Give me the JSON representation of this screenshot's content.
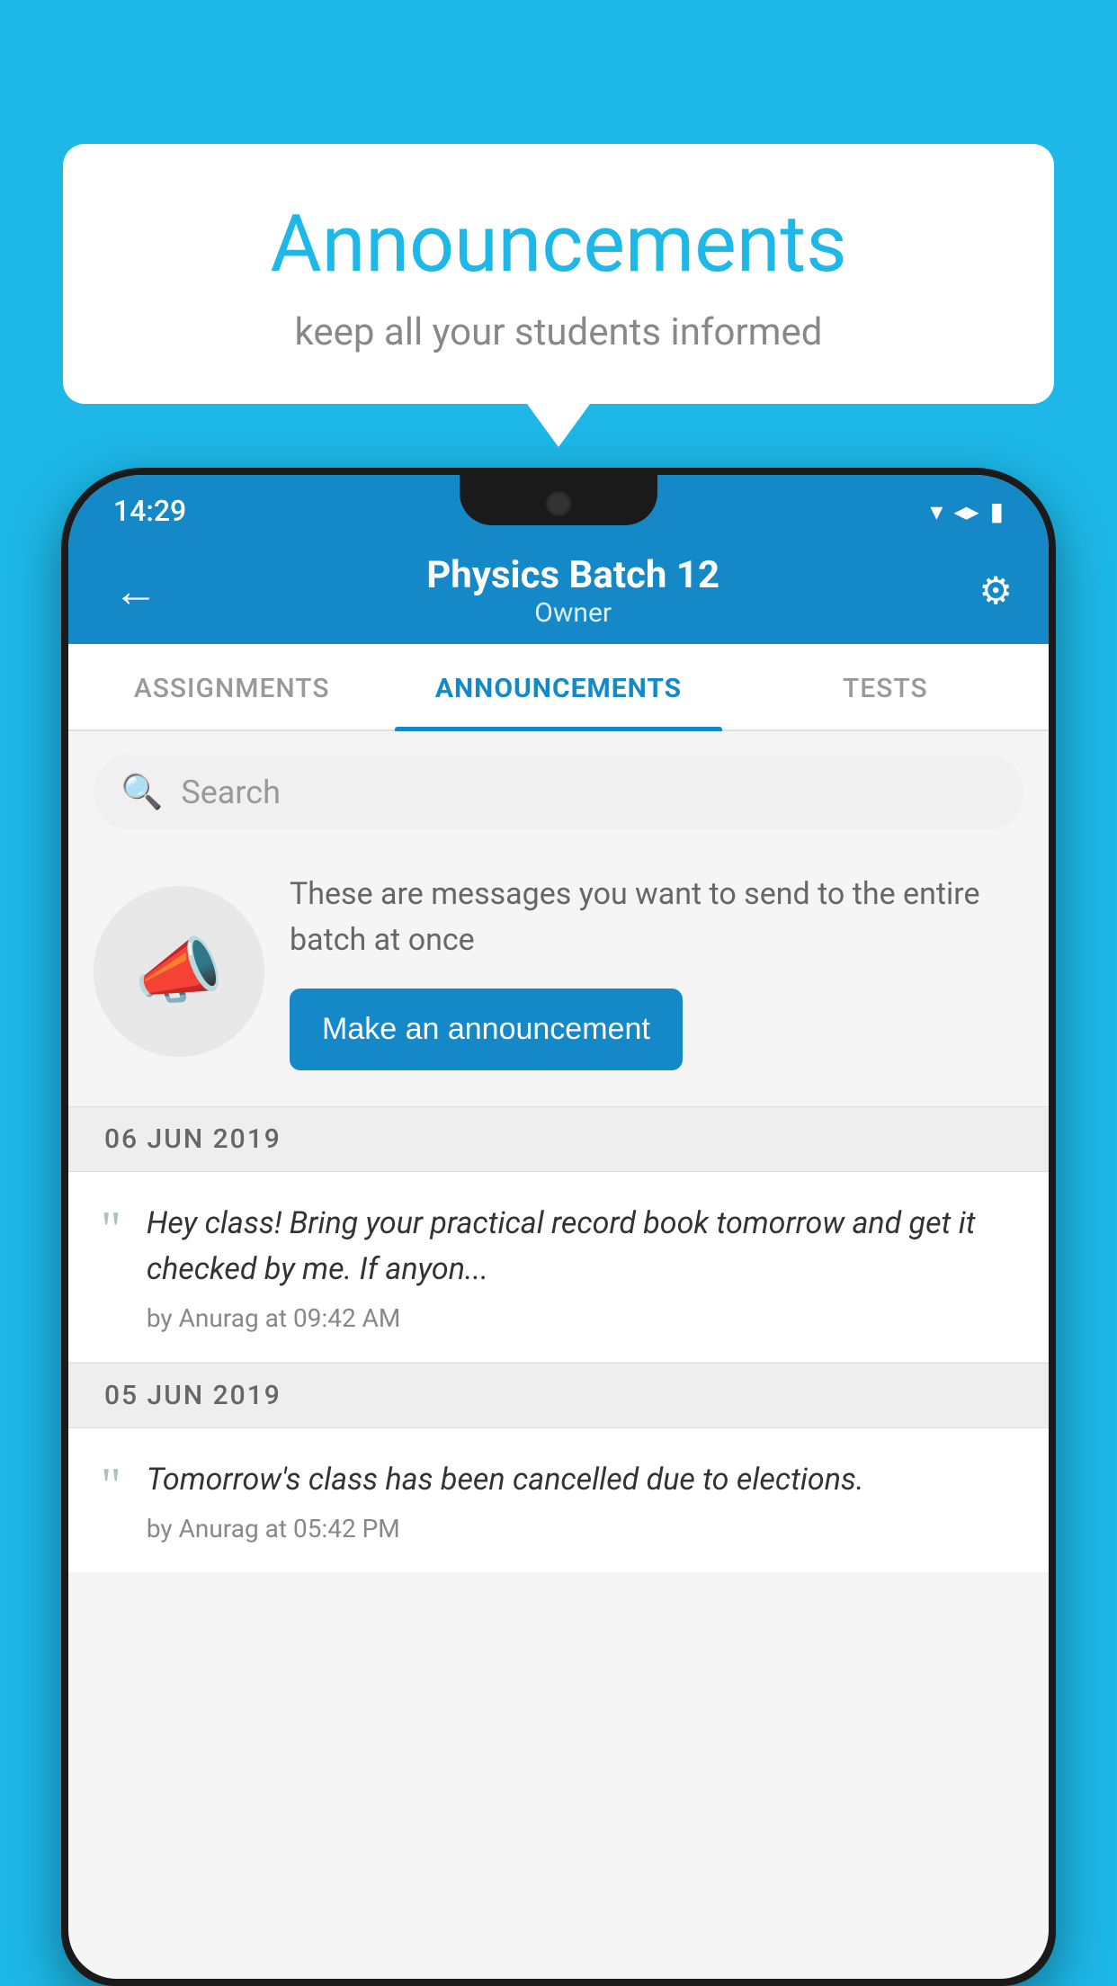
{
  "background_color": "#1db8e8",
  "bubble": {
    "title": "Announcements",
    "subtitle": "keep all your students informed"
  },
  "status_bar": {
    "time": "14:29",
    "wifi": "▾",
    "signal": "▲",
    "battery": "▮"
  },
  "header": {
    "title": "Physics Batch 12",
    "subtitle": "Owner",
    "back_label": "←",
    "settings_label": "⚙"
  },
  "tabs": [
    {
      "label": "ASSIGNMENTS",
      "active": false
    },
    {
      "label": "ANNOUNCEMENTS",
      "active": true
    },
    {
      "label": "TESTS",
      "active": false
    }
  ],
  "search": {
    "placeholder": "Search"
  },
  "promo": {
    "description": "These are messages you want to send to the entire batch at once",
    "button_label": "Make an announcement"
  },
  "announcements": [
    {
      "date": "06  JUN  2019",
      "message": "Hey class! Bring your practical record book tomorrow and get it checked by me. If anyon...",
      "meta": "by Anurag at 09:42 AM"
    },
    {
      "date": "05  JUN  2019",
      "message": "Tomorrow's class has been cancelled due to elections.",
      "meta": "by Anurag at 05:42 PM"
    }
  ]
}
